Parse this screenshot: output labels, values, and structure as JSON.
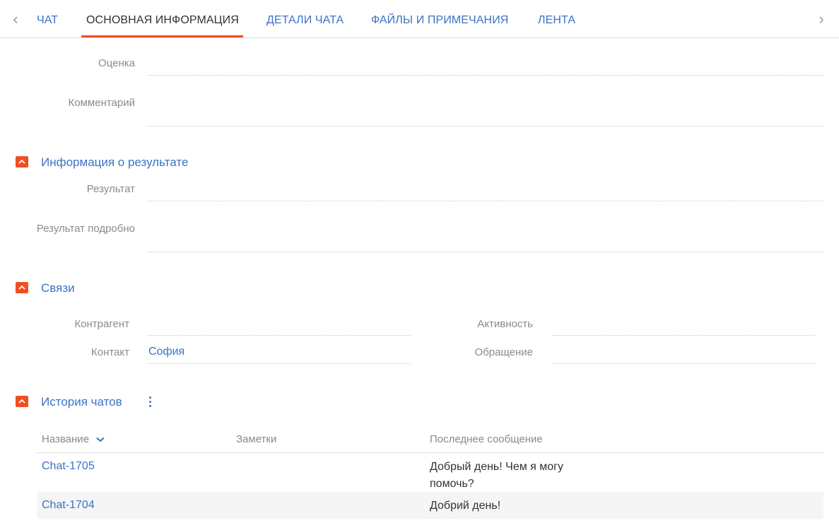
{
  "tabs": [
    {
      "label": "Чат"
    },
    {
      "label": "Основная информация"
    },
    {
      "label": "Детали чата"
    },
    {
      "label": "Файлы и примечания"
    },
    {
      "label": "Лента"
    }
  ],
  "active_tab": "Основная информация",
  "fields_top": {
    "rating_label": "Оценка",
    "comment_label": "Комментарий"
  },
  "result_section": {
    "title": "Информация о результате",
    "result_label": "Результат",
    "result_detail_label": "Результат подробно"
  },
  "links_section": {
    "title": "Связи",
    "account_label": "Контрагент",
    "contact_label": "Контакт",
    "contact_value": "София",
    "activity_label": "Активность",
    "case_label": "Обращение"
  },
  "history_section": {
    "title": "История чатов",
    "columns": [
      "Название",
      "Заметки",
      "Последнее сообщение"
    ],
    "rows": [
      {
        "name": "Chat-1705",
        "notes": "",
        "last_message": "Добрый день! Чем я могу помочь?"
      },
      {
        "name": "Chat-1704",
        "notes": "",
        "last_message": "Добрий день!"
      }
    ]
  },
  "colors": {
    "accent": "#f04e23",
    "link": "#3a73c6",
    "label": "#8a8a8a"
  }
}
